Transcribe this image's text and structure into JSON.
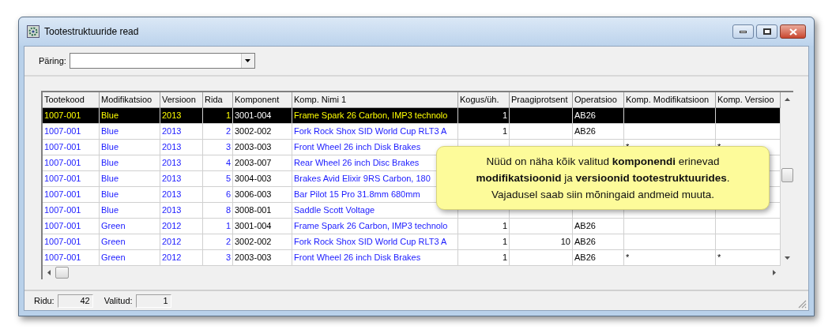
{
  "window": {
    "title": "Tootestruktuuride read"
  },
  "query": {
    "label": "Päring:"
  },
  "table": {
    "columns": [
      {
        "label": "Tootekood",
        "kind": "link"
      },
      {
        "label": "Modifikatsioo",
        "kind": "link"
      },
      {
        "label": "Versioon",
        "kind": "link"
      },
      {
        "label": "Rida",
        "kind": "link-number"
      },
      {
        "label": "Komponent",
        "kind": "plain"
      },
      {
        "label": "Komp. Nimi 1",
        "kind": "link"
      },
      {
        "label": "Kogus/üh.",
        "kind": "number"
      },
      {
        "label": "Praagiprotsent",
        "kind": "number"
      },
      {
        "label": "Operatsioo",
        "kind": "plain"
      },
      {
        "label": "Komp. Modifikatsioon",
        "kind": "plain"
      },
      {
        "label": "Komp. Versioo",
        "kind": "plain"
      }
    ],
    "rows": [
      {
        "selected": true,
        "cells": [
          "1007-001",
          "Blue",
          "2013",
          "1",
          "3001-004",
          "Frame Spark 26 Carbon, IMP3 technolo",
          "1",
          null,
          "AB26",
          null,
          null
        ]
      },
      {
        "selected": false,
        "cells": [
          "1007-001",
          "Blue",
          "2013",
          "2",
          "3002-002",
          "Fork Rock Shox SID World Cup RLT3 A",
          "1",
          null,
          "AB26",
          null,
          null
        ]
      },
      {
        "selected": false,
        "cells": [
          "1007-001",
          "Blue",
          "2013",
          "3",
          "2003-003",
          "Front Wheel 26 inch Disk Brakes",
          null,
          null,
          null,
          "*",
          "*"
        ]
      },
      {
        "selected": false,
        "cells": [
          "1007-001",
          "Blue",
          "2013",
          "4",
          "2003-007",
          "Rear Wheel 26 inch Disc Brakes",
          null,
          null,
          null,
          null,
          null
        ]
      },
      {
        "selected": false,
        "cells": [
          "1007-001",
          "Blue",
          "2013",
          "5",
          "3004-003",
          "Brakes Avid Elixir 9RS Carbon, 180",
          null,
          null,
          null,
          null,
          null
        ]
      },
      {
        "selected": false,
        "cells": [
          "1007-001",
          "Blue",
          "2013",
          "6",
          "3006-003",
          "Bar Pilot 15 Pro 31.8mm 680mm",
          null,
          null,
          null,
          null,
          null
        ]
      },
      {
        "selected": false,
        "cells": [
          "1007-001",
          "Blue",
          "2013",
          "8",
          "3008-001",
          "Saddle Scott Voltage",
          null,
          null,
          null,
          null,
          null
        ]
      },
      {
        "selected": false,
        "cells": [
          "1007-001",
          "Green",
          "2012",
          "1",
          "3001-004",
          "Frame Spark 26 Carbon, IMP3 technolo",
          "1",
          null,
          "AB26",
          null,
          null
        ]
      },
      {
        "selected": false,
        "cells": [
          "1007-001",
          "Green",
          "2012",
          "2",
          "3002-002",
          "Fork Rock Shox SID World Cup RLT3 A",
          "1",
          "10",
          "AB26",
          null,
          null
        ]
      },
      {
        "selected": false,
        "cells": [
          "1007-001",
          "Green",
          "2012",
          "3",
          "2003-003",
          "Front Wheel 26 inch Disk Brakes",
          "1",
          null,
          "AB26",
          "*",
          "*"
        ]
      }
    ]
  },
  "callout": {
    "text": "Nüüd on näha kõik valitud **komponendi** erinevad\n**modifikatsioonid** ja **versioonid tootestruktuurides**.\nVajadusel saab siin mõningaid andmeid muuta."
  },
  "status_bar": [
    {
      "label": "Ridu:",
      "value": "42"
    },
    {
      "label": "Valitud:",
      "value": "1"
    }
  ]
}
